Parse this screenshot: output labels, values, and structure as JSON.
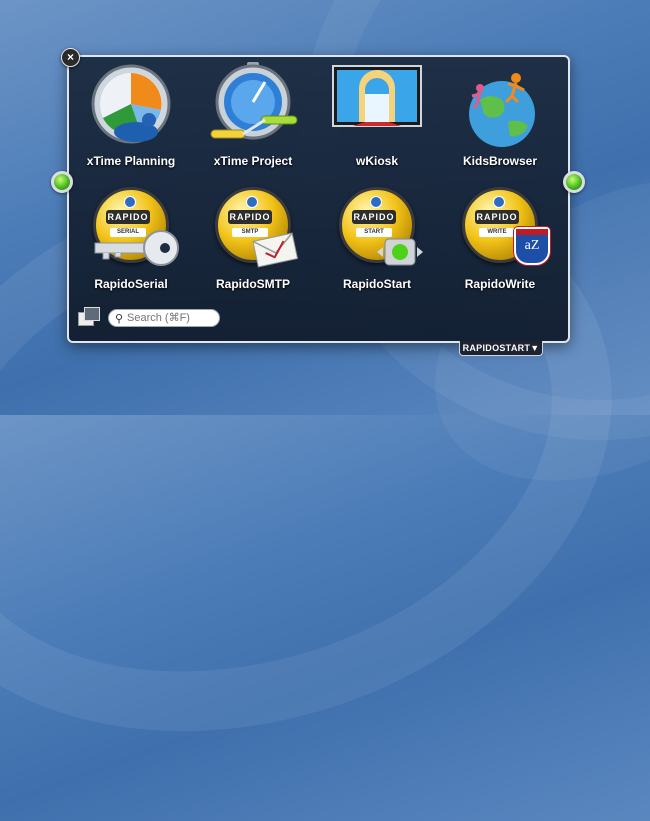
{
  "launcher": {
    "close_glyph": "×",
    "apps": [
      {
        "label": "xTime Planning",
        "icon": "pie-clock-icon"
      },
      {
        "label": "xTime Project",
        "icon": "stopwatch-icon"
      },
      {
        "label": "wKiosk",
        "icon": "kiosk-gate-icon"
      },
      {
        "label": "KidsBrowser",
        "icon": "globe-kids-icon"
      },
      {
        "label": "RapidoSerial",
        "icon": "rapido-serial-icon",
        "medal_sub": "SERIAL"
      },
      {
        "label": "RapidoSMTP",
        "icon": "rapido-smtp-icon",
        "medal_sub": "SMTP"
      },
      {
        "label": "RapidoStart",
        "icon": "rapido-start-icon",
        "medal_sub": "START"
      },
      {
        "label": "RapidoWrite",
        "icon": "rapido-write-icon",
        "medal_sub": "WRITE"
      }
    ],
    "medal_brand": "RAPIDO",
    "write_badge": "aZ",
    "search": {
      "placeholder": "Search (⌘F)",
      "value": ""
    },
    "brand_tab": "RAPIDOSTART▼"
  },
  "colors": {
    "accent_green": "#3fb21a",
    "medal_gold": "#f2c318",
    "panel_bg": "#1c2c42"
  }
}
